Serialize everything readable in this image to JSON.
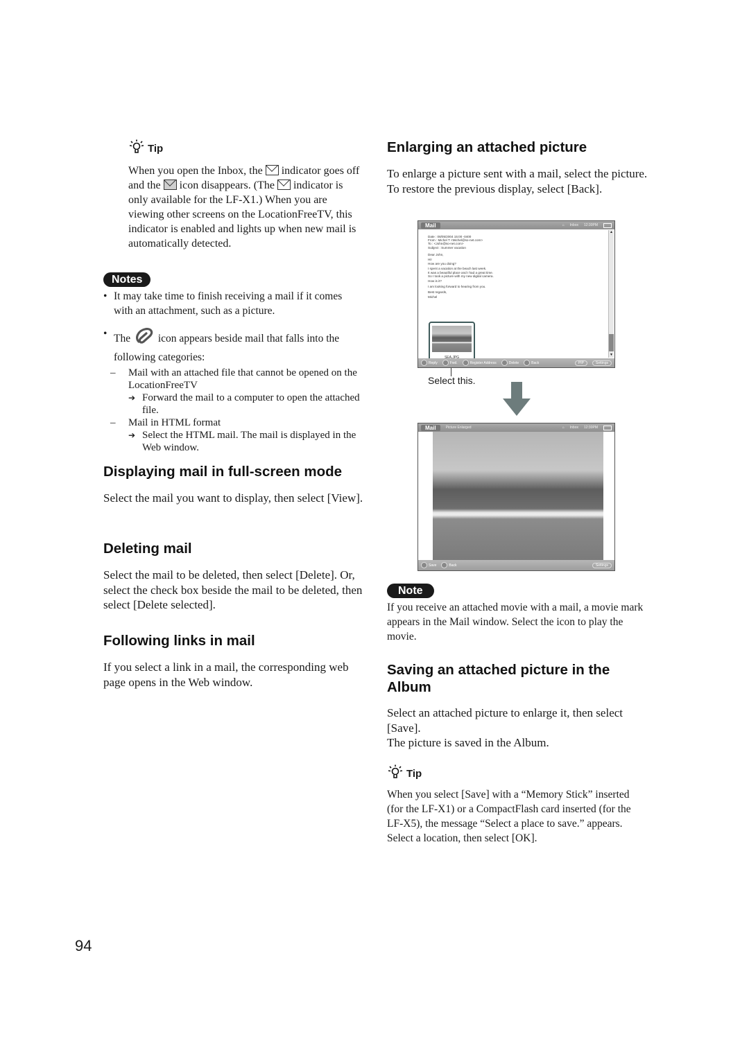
{
  "page_number": "94",
  "left": {
    "tip": {
      "label": "Tip",
      "text_parts": [
        "When you open the Inbox, the ",
        " indicator goes off and the ",
        " icon disappears. (The ",
        " indicator is only available for the LF-X1.) When you are viewing other screens on the LocationFreeTV, this indicator is enabled and lights up when new mail is automatically detected."
      ]
    },
    "notes": {
      "label": "Notes",
      "bullet1": "It may take time to finish receiving a mail if it comes with an attachment, such as a picture.",
      "bullet2_pre": "The ",
      "bullet2_post": " icon appears beside mail that falls into the following categories:",
      "sub1": "Mail with an attached file that cannot be opened on the LocationFreeTV",
      "sub1_action": "Forward the mail to a computer to open the attached file.",
      "sub2": "Mail in HTML format",
      "sub2_action": "Select the HTML mail. The mail is displayed in the Web window.",
      "dash": "–",
      "arrow": "➔"
    },
    "sections": [
      {
        "heading": "Displaying mail in full-screen mode",
        "body": "Select the mail you want to display, then select [View]."
      },
      {
        "heading": "Deleting mail",
        "body": "Select the mail to be deleted, then select [Delete]. Or, select the check box beside the mail to be deleted, then select [Delete selected]."
      },
      {
        "heading": "Following links in mail",
        "body": "If you select a link in a mail, the corresponding web page opens in the Web window."
      }
    ]
  },
  "right": {
    "enlarge": {
      "heading": "Enlarging an attached picture",
      "body": "To enlarge a picture sent with a mail, select the picture. To restore the previous display, select [Back]."
    },
    "screen1": {
      "title": "Mail",
      "status_right": "Inbox",
      "clock": "12:30PM",
      "mail_lines": [
        "Date : 08/05/2004 15:00 -0400",
        "From : Michel T <Michel@so-net.com>",
        "To : <John@so-net.com>",
        "Subject : Summer vacation",
        "",
        "",
        "Dear John,",
        "",
        "Hi!",
        "How are you doing?",
        "",
        "I spent a vacation at the beach last week.",
        "It was a beautiful place and I had a great time.",
        "So I took a picture with my new digital camera.",
        "",
        "How is it?",
        "",
        "I am looking forward to hearing from you.",
        "",
        "Best regards,",
        "",
        "Michel"
      ],
      "attachment_name": "SEA.JPG",
      "buttons": [
        "Reply",
        "Fwd.",
        "Register Address",
        "Delete",
        "Back"
      ],
      "right_buttons": [
        "PIP",
        "Settings"
      ],
      "callout": "Select this."
    },
    "screen2": {
      "title": "Mail",
      "subtitle": "Picture Enlarged",
      "status_right": "Inbox",
      "clock": "12:30PM",
      "buttons": [
        "Save",
        "Back"
      ],
      "right_buttons": [
        "Settings"
      ]
    },
    "note": {
      "label": "Note",
      "body": "If you receive an attached movie with a mail, a movie mark appears in the Mail window. Select the icon to play the movie."
    },
    "saving": {
      "heading": "Saving an attached picture in the Album",
      "body1": "Select an attached picture to enlarge it, then select [Save].",
      "body2": "The picture is saved in the Album."
    },
    "tip2": {
      "label": "Tip",
      "body": "When you select [Save] with a “Memory Stick” inserted (for the LF-X1) or a CompactFlash card inserted (for the LF-X5), the message “Select a place to save.” appears. Select a location, then select [OK]."
    }
  }
}
